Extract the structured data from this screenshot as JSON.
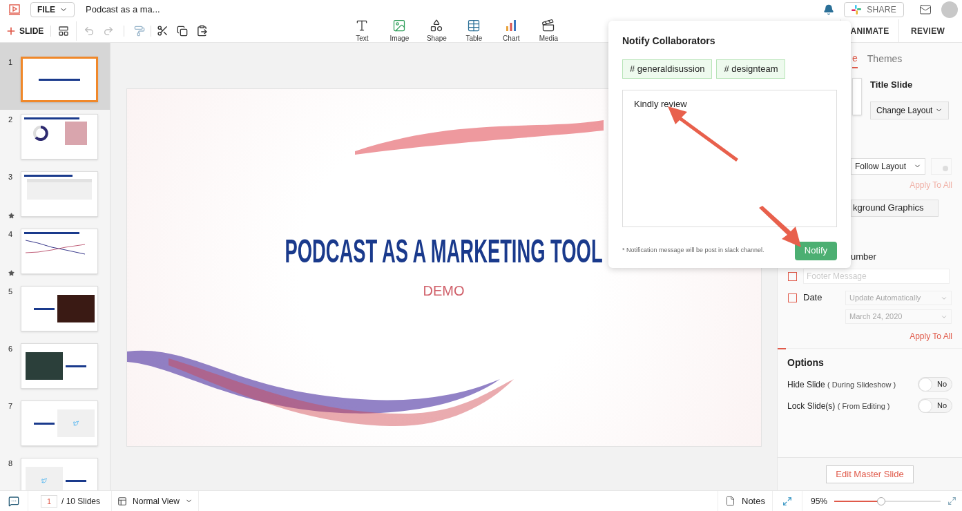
{
  "header": {
    "file_menu": "FILE",
    "document_title": "Podcast as a ma...",
    "share": "SHARE"
  },
  "toolbar": {
    "add_slide": "SLIDE",
    "insert_tools": [
      {
        "label": "Text",
        "kind": "text"
      },
      {
        "label": "Image",
        "kind": "image"
      },
      {
        "label": "Shape",
        "kind": "shape"
      },
      {
        "label": "Table",
        "kind": "table"
      },
      {
        "label": "Chart",
        "kind": "chart"
      },
      {
        "label": "Media",
        "kind": "media"
      }
    ]
  },
  "top_tabs": [
    {
      "label": "ANIMATE",
      "selected": false
    },
    {
      "label": "REVIEW",
      "selected": false
    }
  ],
  "slides": [
    {
      "number": "1",
      "selected": true,
      "kind": "title",
      "animated": false
    },
    {
      "number": "2",
      "selected": false,
      "kind": "donut",
      "animated": false
    },
    {
      "number": "3",
      "selected": false,
      "kind": "table",
      "animated": true
    },
    {
      "number": "4",
      "selected": false,
      "kind": "line",
      "animated": true
    },
    {
      "number": "5",
      "selected": false,
      "kind": "video",
      "animated": false
    },
    {
      "number": "6",
      "selected": false,
      "kind": "photo",
      "animated": false
    },
    {
      "number": "7",
      "selected": false,
      "kind": "tweet",
      "animated": false
    },
    {
      "number": "8",
      "selected": false,
      "kind": "tweet_left",
      "animated": false
    }
  ],
  "slide": {
    "title": "PODCAST AS A MARKETING TOOL",
    "subtitle": "DEMO"
  },
  "notify_popup": {
    "title": "Notify Collaborators",
    "channels": [
      "# generaldisussion",
      "# designteam"
    ],
    "message": "Kindly review",
    "footnote": "* Notification message will be post in slack channel.",
    "button": "Notify"
  },
  "panel": {
    "tabs": [
      {
        "label": "e",
        "selected": true
      },
      {
        "label": "Themes",
        "selected": false
      }
    ],
    "layout_name": "Title Slide",
    "change_layout": "Change Layout",
    "background_select": "Follow Layout",
    "apply_all_disabled": "Apply To All",
    "background_graphics": "kground Graphics",
    "number_label": "umber",
    "footer": {
      "checked": false,
      "placeholder": "Footer Message"
    },
    "date": {
      "label": "Date",
      "checked": false,
      "mode": "Update Automatically",
      "value": "March 24, 2020"
    },
    "apply_all": "Apply To All",
    "options_title": "Options",
    "options": [
      {
        "label": "Hide Slide",
        "note": "( During Slideshow )",
        "on": false,
        "state_text": "No"
      },
      {
        "label": "Lock Slide(s)",
        "note": "( From Editing )",
        "on": false,
        "state_text": "No"
      }
    ],
    "edit_master": "Edit Master Slide"
  },
  "status_bar": {
    "page": "1",
    "total": "/ 10 Slides",
    "view": "Normal View",
    "notes": "Notes",
    "zoom": "95%",
    "level": 0.44
  }
}
